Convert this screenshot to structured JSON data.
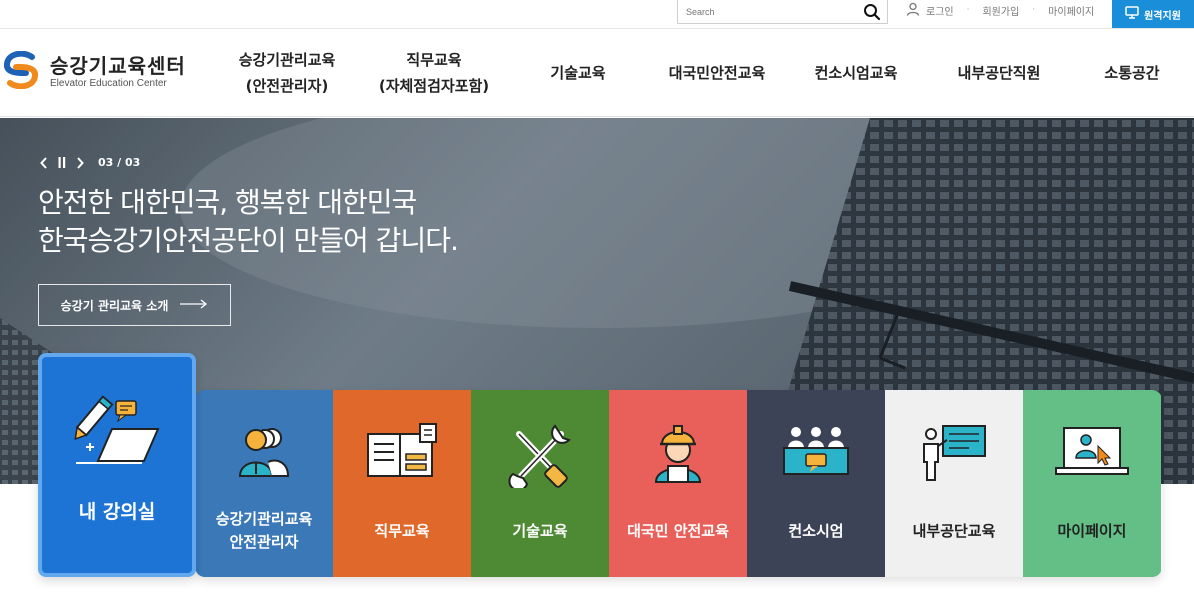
{
  "topbar": {
    "search_placeholder": "Search",
    "login": "로그인",
    "signup": "회원가입",
    "mypage": "마이페이지",
    "remote_support": "원격지원"
  },
  "logo": {
    "title": "승강기교육센터",
    "subtitle": "Elevator Education Center"
  },
  "gnb": [
    {
      "line1": "승강기관리교육",
      "line2": "(안전관리자)"
    },
    {
      "line1": "직무교육",
      "line2": "(자체점검자포함)"
    },
    {
      "line1": "기술교육",
      "line2": ""
    },
    {
      "line1": "대국민안전교육",
      "line2": ""
    },
    {
      "line1": "컨소시엄교육",
      "line2": ""
    },
    {
      "line1": "내부공단직원",
      "line2": ""
    },
    {
      "line1": "소통공간",
      "line2": ""
    }
  ],
  "hero": {
    "slide_indicator": "03 / 03",
    "title_line1": "안전한 대한민국, 행복한 대한민국",
    "title_line2": "한국승강기안전공단이 만들어 갑니다.",
    "intro_button": "승강기 관리교육 소개"
  },
  "quick_menu": {
    "my_class": "내 강의실",
    "items": [
      {
        "line1": "승강기관리교육",
        "line2": "안전관리자",
        "color": "#3a78b8"
      },
      {
        "line1": "직무교육",
        "line2": "",
        "color": "#e0682b"
      },
      {
        "line1": "기술교육",
        "line2": "",
        "color": "#4e8a33"
      },
      {
        "line1": "대국민 안전교육",
        "line2": "",
        "color": "#e95f59"
      },
      {
        "line1": "컨소시엄",
        "line2": "",
        "color": "#3c4357"
      },
      {
        "line1": "내부공단교육",
        "line2": "",
        "color": "#f0f0f0"
      },
      {
        "line1": "마이페이지",
        "line2": "",
        "color": "#63bf86"
      }
    ]
  },
  "colors": {
    "accent_blue": "#1a8ed8",
    "my_class_blue": "#1d74d5"
  }
}
